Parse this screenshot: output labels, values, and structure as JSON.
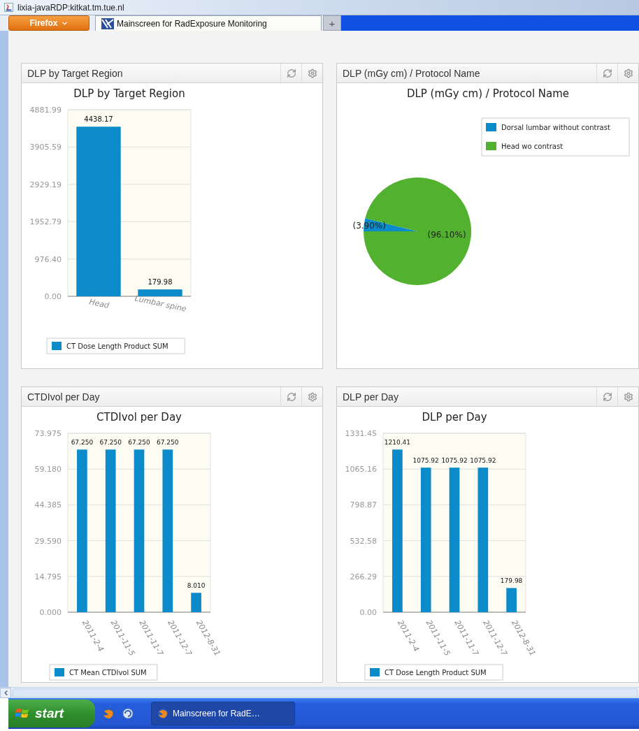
{
  "window": {
    "title": "lixia-javaRDP:kitkat.tm.tue.nl"
  },
  "browser": {
    "menu_button": "Firefox",
    "tabs": [
      {
        "label": "Mainscreen for RadExposure Monitoring",
        "selected": true
      }
    ],
    "new_tab": "+"
  },
  "panels": [
    {
      "title": "DLP by Target Region",
      "chart_data": {
        "type": "bar",
        "title": "DLP by Target Region",
        "categories": [
          "Head",
          "Lumbar spine"
        ],
        "series": [
          {
            "name": "CT Dose Length Product SUM",
            "color": "#0b8bc9",
            "values": [
              4438.17,
              179.98
            ]
          }
        ],
        "ylim": [
          0,
          4881.99
        ],
        "yticks": [
          {
            "value": 0,
            "label": "0.00"
          },
          {
            "value": 976.4,
            "label": "976.40"
          },
          {
            "value": 1952.79,
            "label": "1952.79"
          },
          {
            "value": 2929.19,
            "label": "2929.19"
          },
          {
            "value": 3905.59,
            "label": "3905.59"
          },
          {
            "value": 4881.99,
            "label": "4881.99"
          }
        ],
        "value_labels": [
          "4438.17",
          "179.98"
        ],
        "grid": true,
        "legend": true
      }
    },
    {
      "title": "DLP (mGy cm) / Protocol Name",
      "chart_data": {
        "type": "pie",
        "title": "DLP (mGy cm) / Protocol Name",
        "categories": [
          "Dorsal lumbar without contrast",
          "Head wo contrast"
        ],
        "values": [
          3.9,
          96.1
        ],
        "colors": [
          "#0b8bc9",
          "#53b130"
        ],
        "value_labels": [
          "(3.90%)",
          "(96.10%)"
        ],
        "legend": true
      }
    },
    {
      "title": "CTDIvol per Day",
      "chart_data": {
        "type": "bar",
        "title": "CTDIvol per Day",
        "categories": [
          "2011-2-4",
          "2011-11-5",
          "2011-11-7",
          "2011-12-7",
          "2012-8-31"
        ],
        "series": [
          {
            "name": "CT Mean CTDIvol SUM",
            "color": "#0b8bc9",
            "values": [
              67.25,
              67.25,
              67.25,
              67.25,
              8.01
            ]
          }
        ],
        "ylim": [
          0,
          73.975
        ],
        "yticks": [
          {
            "value": 0,
            "label": "0.000"
          },
          {
            "value": 14.795,
            "label": "14.795"
          },
          {
            "value": 29.59,
            "label": "29.590"
          },
          {
            "value": 44.385,
            "label": "44.385"
          },
          {
            "value": 59.18,
            "label": "59.180"
          },
          {
            "value": 73.975,
            "label": "73.975"
          }
        ],
        "value_labels": [
          "67.250",
          "67.250",
          "67.250",
          "67.250",
          "8.010"
        ],
        "grid": true,
        "legend": true
      }
    },
    {
      "title": "DLP per Day",
      "chart_data": {
        "type": "bar",
        "title": "DLP per Day",
        "categories": [
          "2011-2-4",
          "2011-11-5",
          "2011-11-7",
          "2011-12-7",
          "2012-8-31"
        ],
        "series": [
          {
            "name": "CT Dose Length Product SUM",
            "color": "#0b8bc9",
            "values": [
              1210.41,
              1075.92,
              1075.92,
              1075.92,
              179.98
            ]
          }
        ],
        "ylim": [
          0,
          1331.45
        ],
        "yticks": [
          {
            "value": 0,
            "label": "0.00"
          },
          {
            "value": 266.29,
            "label": "266.29"
          },
          {
            "value": 532.58,
            "label": "532.58"
          },
          {
            "value": 798.87,
            "label": "798.87"
          },
          {
            "value": 1065.16,
            "label": "1065.16"
          },
          {
            "value": 1331.45,
            "label": "1331.45"
          }
        ],
        "value_labels": [
          "1210.41",
          "1075.92",
          "1075.92",
          "1075.92",
          "179.98"
        ],
        "grid": true,
        "legend": true
      }
    }
  ],
  "taskbar": {
    "start": "start",
    "tasks": [
      {
        "label": "Mainscreen for RadE…",
        "selected": true
      }
    ]
  }
}
